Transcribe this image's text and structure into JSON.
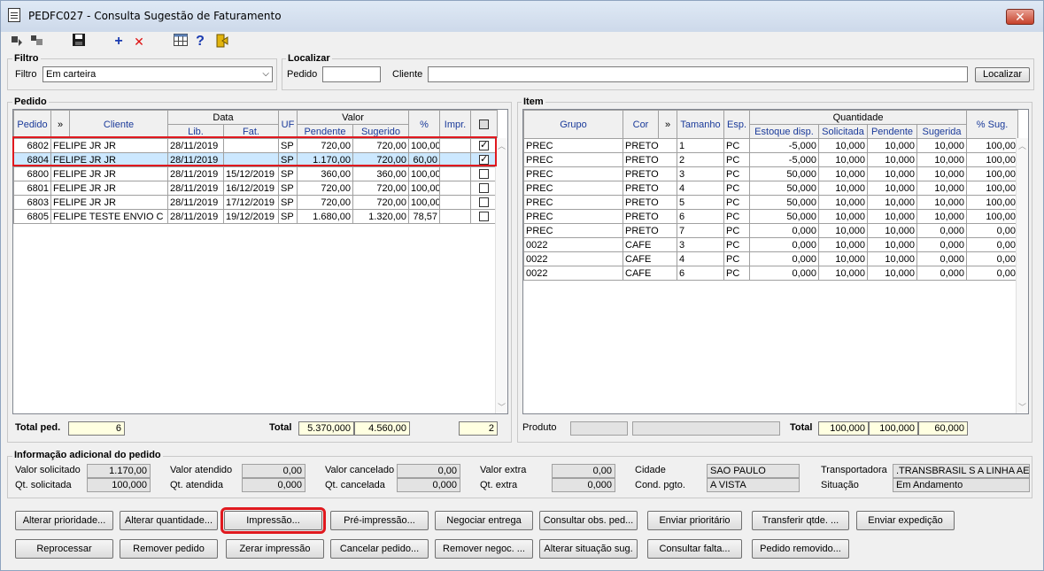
{
  "window": {
    "title": "PEDFC027 - Consulta Sugestão de Faturamento",
    "close_label": "✕"
  },
  "toolbar": {
    "icons": [
      "arrow-down-icon",
      "arrow-up-icon",
      "save-icon",
      "add-icon",
      "delete-icon",
      "grid-icon",
      "help-icon",
      "exit-icon"
    ],
    "add": "+",
    "delete": "✕",
    "help": "?"
  },
  "filtro": {
    "title": "Filtro",
    "label": "Filtro",
    "value": "Em carteira"
  },
  "localizar": {
    "title": "Localizar",
    "pedido_label": "Pedido",
    "pedido_value": "",
    "cliente_label": "Cliente",
    "cliente_value": "",
    "button": "Localizar"
  },
  "pedido": {
    "title": "Pedido",
    "headers": {
      "pedido": "Pedido",
      "more": "»",
      "cliente": "Cliente",
      "data": "Data",
      "lib": "Lib.",
      "fat": "Fat.",
      "uf": "UF",
      "valor": "Valor",
      "pendente": "Pendente",
      "sugerido": "Sugerido",
      "pct": "%",
      "impr": "Impr."
    },
    "rows": [
      {
        "pedido": "6802",
        "cliente": "FELIPE JR JR",
        "lib": "28/11/2019",
        "fat": "",
        "uf": "SP",
        "pendente": "720,00",
        "sugerido": "720,00",
        "pct": "100,00",
        "impr": "",
        "checked": true
      },
      {
        "pedido": "6804",
        "cliente": "FELIPE JR JR",
        "lib": "28/11/2019",
        "fat": "",
        "uf": "SP",
        "pendente": "1.170,00",
        "sugerido": "720,00",
        "pct": "60,00",
        "impr": "",
        "checked": true
      },
      {
        "pedido": "6800",
        "cliente": "FELIPE JR JR",
        "lib": "28/11/2019",
        "fat": "15/12/2019",
        "uf": "SP",
        "pendente": "360,00",
        "sugerido": "360,00",
        "pct": "100,00",
        "impr": "",
        "checked": false
      },
      {
        "pedido": "6801",
        "cliente": "FELIPE JR JR",
        "lib": "28/11/2019",
        "fat": "16/12/2019",
        "uf": "SP",
        "pendente": "720,00",
        "sugerido": "720,00",
        "pct": "100,00",
        "impr": "",
        "checked": false
      },
      {
        "pedido": "6803",
        "cliente": "FELIPE JR JR",
        "lib": "28/11/2019",
        "fat": "17/12/2019",
        "uf": "SP",
        "pendente": "720,00",
        "sugerido": "720,00",
        "pct": "100,00",
        "impr": "",
        "checked": false
      },
      {
        "pedido": "6805",
        "cliente": "FELIPE TESTE ENVIO C",
        "lib": "28/11/2019",
        "fat": "19/12/2019",
        "uf": "SP",
        "pendente": "1.680,00",
        "sugerido": "1.320,00",
        "pct": "78,57",
        "impr": "",
        "checked": false
      }
    ],
    "total_ped_label": "Total ped.",
    "total_ped_value": "6",
    "total_label": "Total",
    "total_pendente": "5.370,000",
    "total_sugerido": "4.560,00",
    "total_checked": "2"
  },
  "item": {
    "title": "Item",
    "headers": {
      "grupo": "Grupo",
      "cor": "Cor",
      "more": "»",
      "tamanho": "Tamanho",
      "esp": "Esp.",
      "quantidade": "Quantidade",
      "estoque": "Estoque disp.",
      "solicitada": "Solicitada",
      "pendente": "Pendente",
      "sugerida": "Sugerida",
      "pct_sug": "% Sug."
    },
    "rows": [
      {
        "grupo": "PREC",
        "cor": "PRETO",
        "tam": "1",
        "esp": "PC",
        "estoque": "-5,000",
        "solicitada": "10,000",
        "pendente": "10,000",
        "sugerida": "10,000",
        "pct": "100,00"
      },
      {
        "grupo": "PREC",
        "cor": "PRETO",
        "tam": "2",
        "esp": "PC",
        "estoque": "-5,000",
        "solicitada": "10,000",
        "pendente": "10,000",
        "sugerida": "10,000",
        "pct": "100,00"
      },
      {
        "grupo": "PREC",
        "cor": "PRETO",
        "tam": "3",
        "esp": "PC",
        "estoque": "50,000",
        "solicitada": "10,000",
        "pendente": "10,000",
        "sugerida": "10,000",
        "pct": "100,00"
      },
      {
        "grupo": "PREC",
        "cor": "PRETO",
        "tam": "4",
        "esp": "PC",
        "estoque": "50,000",
        "solicitada": "10,000",
        "pendente": "10,000",
        "sugerida": "10,000",
        "pct": "100,00"
      },
      {
        "grupo": "PREC",
        "cor": "PRETO",
        "tam": "5",
        "esp": "PC",
        "estoque": "50,000",
        "solicitada": "10,000",
        "pendente": "10,000",
        "sugerida": "10,000",
        "pct": "100,00"
      },
      {
        "grupo": "PREC",
        "cor": "PRETO",
        "tam": "6",
        "esp": "PC",
        "estoque": "50,000",
        "solicitada": "10,000",
        "pendente": "10,000",
        "sugerida": "10,000",
        "pct": "100,00"
      },
      {
        "grupo": "PREC",
        "cor": "PRETO",
        "tam": "7",
        "esp": "PC",
        "estoque": "0,000",
        "solicitada": "10,000",
        "pendente": "10,000",
        "sugerida": "0,000",
        "pct": "0,00"
      },
      {
        "grupo": "0022",
        "cor": "CAFE",
        "tam": "3",
        "esp": "PC",
        "estoque": "0,000",
        "solicitada": "10,000",
        "pendente": "10,000",
        "sugerida": "0,000",
        "pct": "0,00"
      },
      {
        "grupo": "0022",
        "cor": "CAFE",
        "tam": "4",
        "esp": "PC",
        "estoque": "0,000",
        "solicitada": "10,000",
        "pendente": "10,000",
        "sugerida": "0,000",
        "pct": "0,00"
      },
      {
        "grupo": "0022",
        "cor": "CAFE",
        "tam": "6",
        "esp": "PC",
        "estoque": "0,000",
        "solicitada": "10,000",
        "pendente": "10,000",
        "sugerida": "0,000",
        "pct": "0,00"
      }
    ],
    "produto_label": "Produto",
    "total_label": "Total",
    "total_solicitada": "100,000",
    "total_pendente": "100,000",
    "total_sugerida": "60,000"
  },
  "info": {
    "title": "Informação adicional do pedido",
    "valor_solicitado_label": "Valor solicitado",
    "valor_solicitado": "1.170,00",
    "qt_solicitada_label": "Qt. solicitada",
    "qt_solicitada": "100,000",
    "valor_atendido_label": "Valor atendido",
    "valor_atendido": "0,00",
    "qt_atendida_label": "Qt. atendida",
    "qt_atendida": "0,000",
    "valor_cancelado_label": "Valor cancelado",
    "valor_cancelado": "0,00",
    "qt_cancelada_label": "Qt. cancelada",
    "qt_cancelada": "0,000",
    "valor_extra_label": "Valor extra",
    "valor_extra": "0,00",
    "qt_extra_label": "Qt. extra",
    "qt_extra": "0,000",
    "cidade_label": "Cidade",
    "cidade": "SAO PAULO",
    "cond_pgto_label": "Cond. pgto.",
    "cond_pgto": "A VISTA",
    "transportadora_label": "Transportadora",
    "transportadora": ".TRANSBRASIL S A LINHA AERI",
    "situacao_label": "Situação",
    "situacao": "Em Andamento"
  },
  "buttons": {
    "alterar_prioridade": "Alterar prioridade...",
    "alterar_quantidade": "Alterar quantidade...",
    "impressao": "Impressão...",
    "pre_impressao": "Pré-impressão...",
    "negociar_entrega": "Negociar entrega",
    "consultar_obs": "Consultar obs. ped...",
    "enviar_prioritario": "Enviar prioritário",
    "transferir_qtde": "Transferir qtde. ...",
    "enviar_expedicao": "Enviar expedição",
    "reprocessar": "Reprocessar",
    "remover_pedido": "Remover pedido",
    "zerar_impressao": "Zerar impressão",
    "cancelar_pedido": "Cancelar pedido...",
    "remover_negoc": "Remover negoc. ...",
    "alterar_situacao": "Alterar situação sug.",
    "consultar_falta": "Consultar falta...",
    "pedido_removido": "Pedido removido..."
  }
}
